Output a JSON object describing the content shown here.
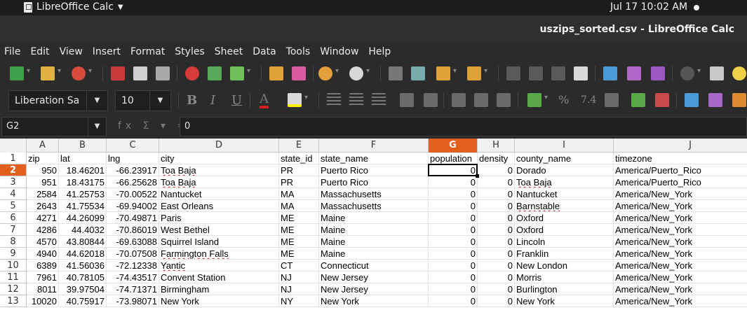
{
  "topbar": {
    "app_name": "LibreOffice Calc",
    "clock": "Jul 17  10:02 AM"
  },
  "window": {
    "title": "uszips_sorted.csv - LibreOffice Calc"
  },
  "menu": [
    "File",
    "Edit",
    "View",
    "Insert",
    "Format",
    "Styles",
    "Sheet",
    "Data",
    "Tools",
    "Window",
    "Help"
  ],
  "format_bar": {
    "font_name": "Liberation Sa",
    "font_size": "10"
  },
  "formula_bar": {
    "cell_ref": "G2",
    "content": "0",
    "fx_label": "fx Σ ▾ ="
  },
  "colors": {
    "selection": "#e2601c",
    "font_color": "#d02020",
    "highlight": "#ffeb00"
  },
  "sheet": {
    "columns": [
      "A",
      "B",
      "C",
      "D",
      "E",
      "F",
      "G",
      "H",
      "I",
      "J"
    ],
    "selected_column": "G",
    "selected_row": "2",
    "rows": [
      {
        "n": "1",
        "cells": [
          "zip",
          "lat",
          "lng",
          "city",
          "state_id",
          "state_name",
          "population",
          "density",
          "county_name",
          "timezone"
        ]
      },
      {
        "n": "2",
        "cells": [
          "950",
          "18.46201",
          "-66.23917",
          "Toa Baja",
          "PR",
          "Puerto Rico",
          "0",
          "0",
          "Dorado",
          "America/Puerto_Rico"
        ]
      },
      {
        "n": "3",
        "cells": [
          "951",
          "18.43175",
          "-66.25628",
          "Toa Baja",
          "PR",
          "Puerto Rico",
          "0",
          "0",
          "Toa Baja",
          "America/Puerto_Rico"
        ]
      },
      {
        "n": "4",
        "cells": [
          "2584",
          "41.25753",
          "-70.00522",
          "Nantucket",
          "MA",
          "Massachusetts",
          "0",
          "0",
          "Nantucket",
          "America/New_York"
        ]
      },
      {
        "n": "5",
        "cells": [
          "2643",
          "41.75534",
          "-69.94002",
          "East Orleans",
          "MA",
          "Massachusetts",
          "0",
          "0",
          "Barnstable",
          "America/New_York"
        ]
      },
      {
        "n": "6",
        "cells": [
          "4271",
          "44.26099",
          "-70.49871",
          "Paris",
          "ME",
          "Maine",
          "0",
          "0",
          "Oxford",
          "America/New_York"
        ]
      },
      {
        "n": "7",
        "cells": [
          "4286",
          "44.4032",
          "-70.86019",
          "West Bethel",
          "ME",
          "Maine",
          "0",
          "0",
          "Oxford",
          "America/New_York"
        ]
      },
      {
        "n": "8",
        "cells": [
          "4570",
          "43.80844",
          "-69.63088",
          "Squirrel Island",
          "ME",
          "Maine",
          "0",
          "0",
          "Lincoln",
          "America/New_York"
        ]
      },
      {
        "n": "9",
        "cells": [
          "4940",
          "44.62018",
          "-70.07508",
          "Farmington Falls",
          "ME",
          "Maine",
          "0",
          "0",
          "Franklin",
          "America/New_York"
        ]
      },
      {
        "n": "10",
        "cells": [
          "6389",
          "41.56036",
          "-72.12338",
          "Yantic",
          "CT",
          "Connecticut",
          "0",
          "0",
          "New London",
          "America/New_York"
        ]
      },
      {
        "n": "11",
        "cells": [
          "7961",
          "40.78105",
          "-74.43517",
          "Convent Station",
          "NJ",
          "New Jersey",
          "0",
          "0",
          "Morris",
          "America/New_York"
        ]
      },
      {
        "n": "12",
        "cells": [
          "8011",
          "39.97504",
          "-74.71371",
          "Birmingham",
          "NJ",
          "New Jersey",
          "0",
          "0",
          "Burlington",
          "America/New_York"
        ]
      },
      {
        "n": "13",
        "cells": [
          "10020",
          "40.75917",
          "-73.98071",
          "New York",
          "NY",
          "New York",
          "0",
          "0",
          "New York",
          "America/New_York"
        ]
      }
    ]
  }
}
